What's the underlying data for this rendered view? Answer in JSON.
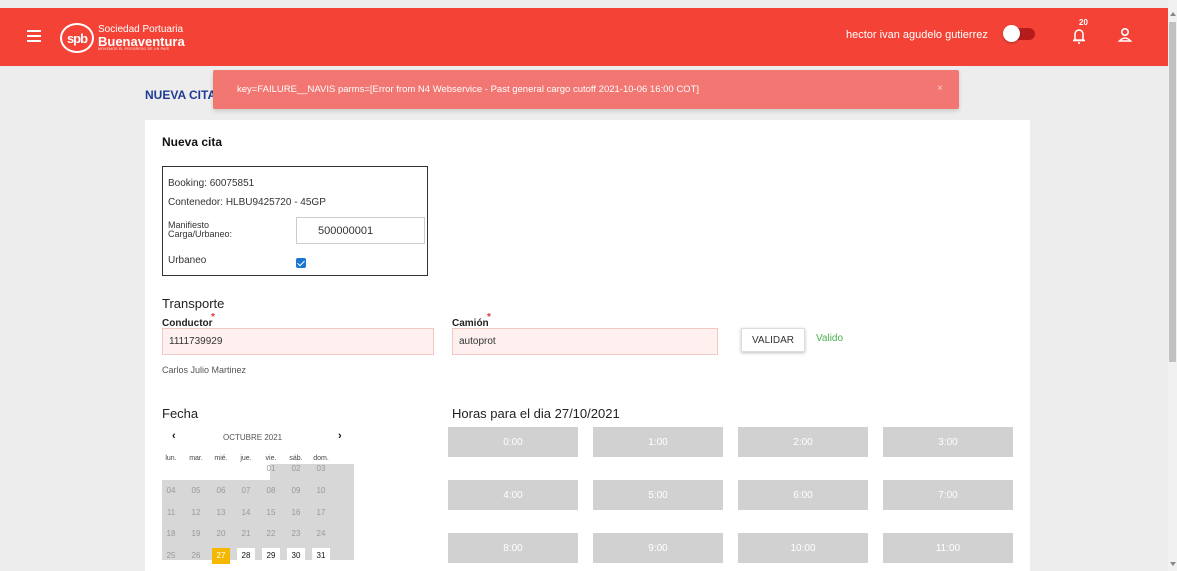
{
  "header": {
    "logo_badge": "spb",
    "logo_line1": "Sociedad Portuaria",
    "logo_line2": "Buenaventura",
    "logo_line3": "MOVEMOS EL PROGRESO DE UN PAÍS",
    "username": "hector ivan agudelo gutierrez",
    "notification_count": "20",
    "brand_color": "#f44336"
  },
  "page": {
    "title": "NUEVA CITA"
  },
  "toast": {
    "message": "key=FAILURE__NAVIS parms=[Error from N4 Webservice - Past general cargo cutoff 2021-10-06 16:00 COT]",
    "close": "×"
  },
  "form": {
    "card_title": "Nueva cita",
    "booking": "Booking: 60075851",
    "container": "Contenedor: HLBU9425720 - 45GP",
    "manifest_label_1": "Manifiesto",
    "manifest_label_2": "Carga/Urbaneo:",
    "manifest_value": "500000001",
    "urbaneo_label": "Urbaneo",
    "urbaneo_checked": true
  },
  "transport": {
    "heading": "Transporte",
    "driver_label": "Conductor",
    "driver_value": "1111739929",
    "driver_name": "Carlos Julio Martinez",
    "truck_label": "Camión",
    "truck_value": "autoprot",
    "required_mark": "*",
    "validate_label": "VALIDAR",
    "valid_text": "Valido"
  },
  "calendar": {
    "heading": "Fecha",
    "prev": "‹",
    "next": "›",
    "month": "OCTUBRE 2021",
    "weekdays": [
      "lun.",
      "mar.",
      "mié.",
      "jue.",
      "vie.",
      "sáb.",
      "dom."
    ],
    "weeks": [
      [
        "",
        "",
        "",
        "",
        "01",
        "02",
        "03"
      ],
      [
        "04",
        "05",
        "06",
        "07",
        "08",
        "09",
        "10"
      ],
      [
        "11",
        "12",
        "13",
        "14",
        "15",
        "16",
        "17"
      ],
      [
        "18",
        "19",
        "20",
        "21",
        "22",
        "23",
        "24"
      ],
      [
        "25",
        "26",
        "27",
        "28",
        "29",
        "30",
        "31"
      ]
    ],
    "selected_day": "27",
    "selected_color": "#f5b800"
  },
  "hours": {
    "heading": "Horas para el dia 27/10/2021",
    "slots": [
      "0:00",
      "1:00",
      "2:00",
      "3:00",
      "4:00",
      "5:00",
      "6:00",
      "7:00",
      "8:00",
      "9:00",
      "10:00",
      "11:00"
    ]
  }
}
